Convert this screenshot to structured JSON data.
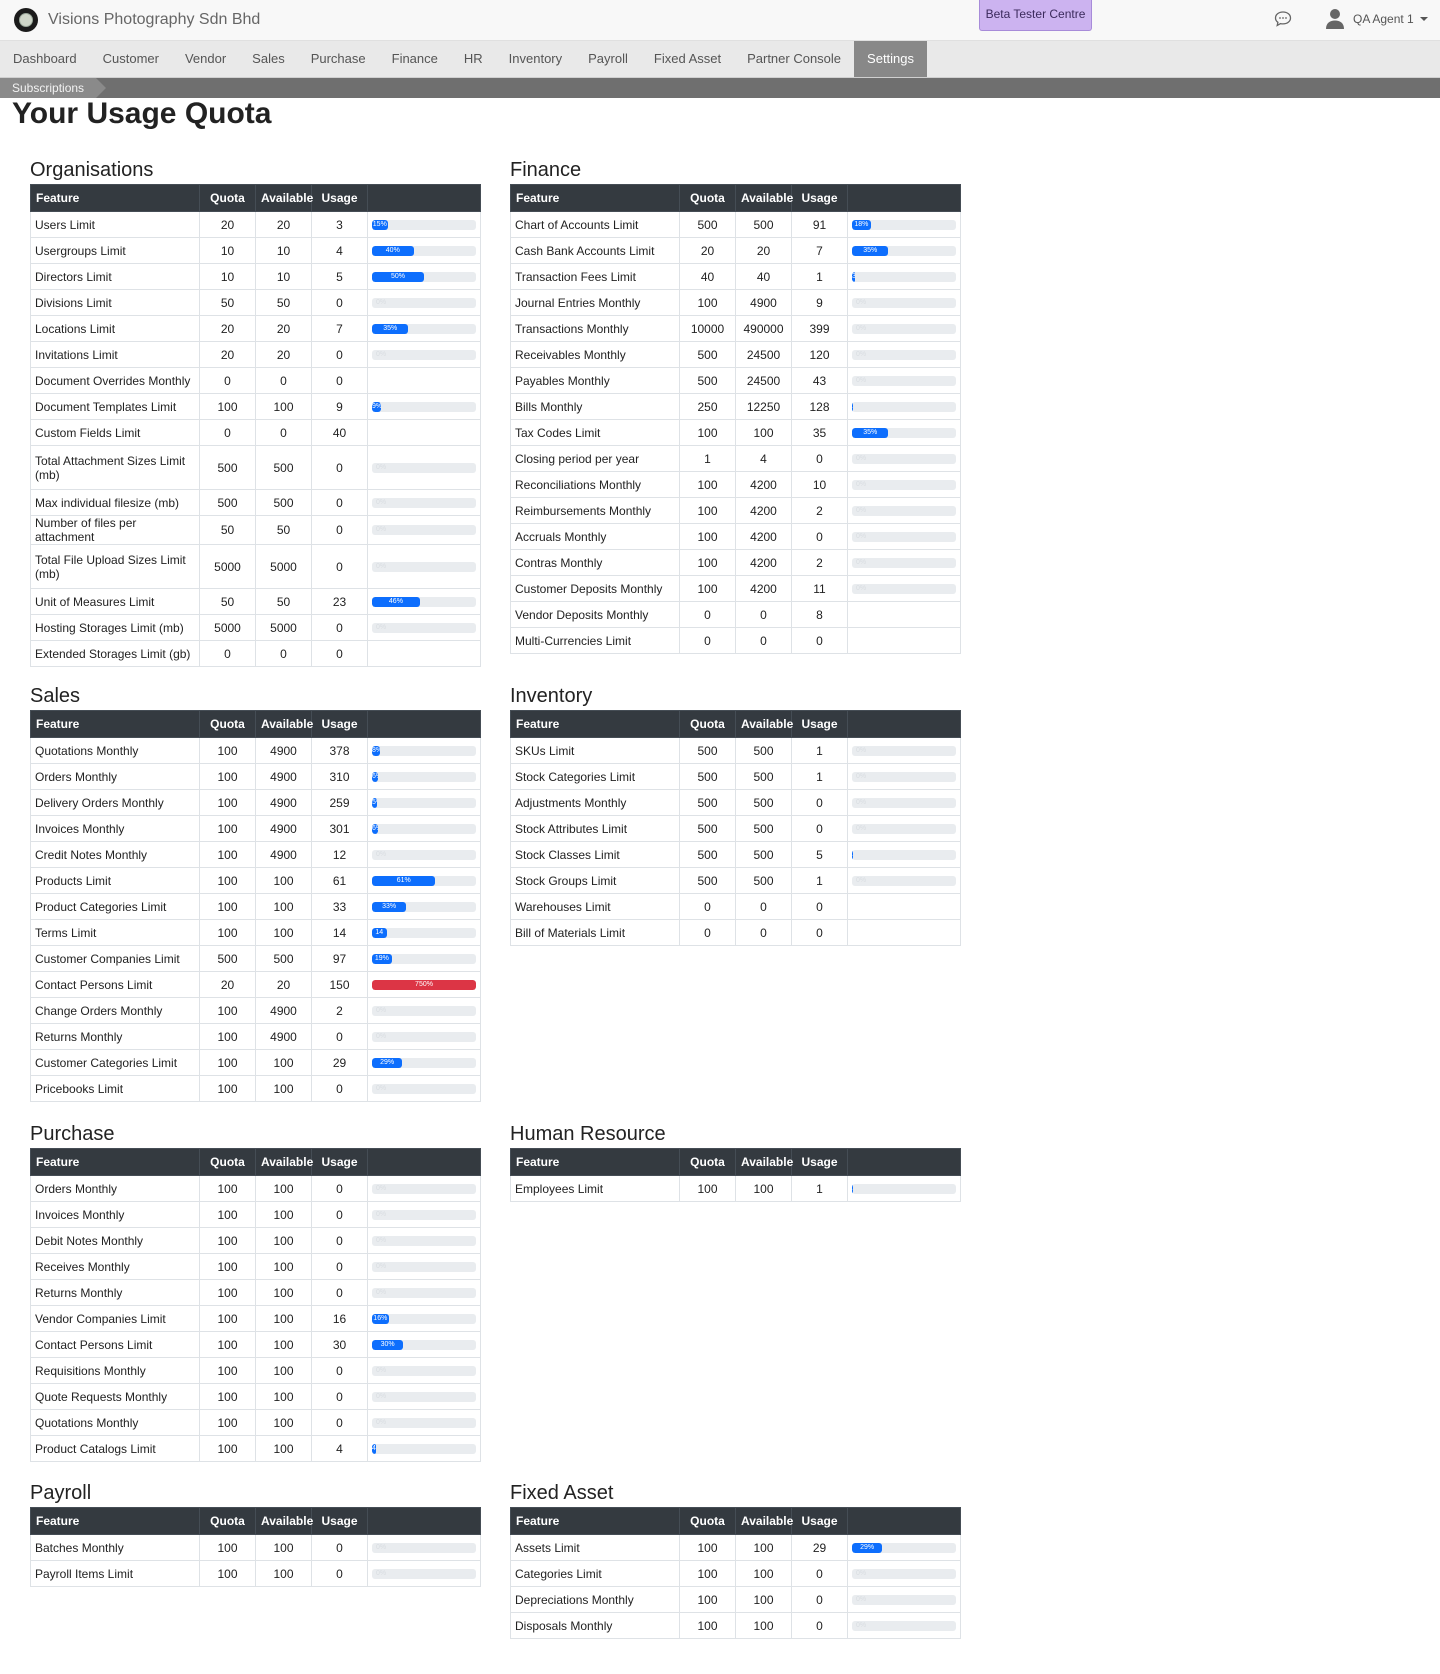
{
  "app": {
    "company": "Visions Photography Sdn Bhd",
    "beta_label": "Beta Tester Centre",
    "user_name": "QA Agent 1"
  },
  "nav": [
    "Dashboard",
    "Customer",
    "Vendor",
    "Sales",
    "Purchase",
    "Finance",
    "HR",
    "Inventory",
    "Payroll",
    "Fixed Asset",
    "Partner Console",
    "Settings"
  ],
  "nav_active": "Settings",
  "subnav": "Subscriptions",
  "page_title": "Your Usage Quota",
  "columns": {
    "feature": "Feature",
    "quota": "Quota",
    "available": "Available",
    "usage": "Usage"
  },
  "colors": {
    "header_bg": "#343a40",
    "progress": "#0d6efd",
    "over_quota": "#dc3545",
    "beta": "#ccb3f0"
  },
  "sections": [
    {
      "id": "organisations",
      "title": "Organisations",
      "rows": [
        {
          "feature": "Users Limit",
          "quota": "20",
          "available": "20",
          "usage": "3",
          "pct": 15,
          "label": "15%"
        },
        {
          "feature": "Usergroups Limit",
          "quota": "10",
          "available": "10",
          "usage": "4",
          "pct": 40,
          "label": "40%"
        },
        {
          "feature": "Directors Limit",
          "quota": "10",
          "available": "10",
          "usage": "5",
          "pct": 50,
          "label": "50%"
        },
        {
          "feature": "Divisions Limit",
          "quota": "50",
          "available": "50",
          "usage": "0",
          "pct": 0,
          "label": "0%"
        },
        {
          "feature": "Locations Limit",
          "quota": "20",
          "available": "20",
          "usage": "7",
          "pct": 35,
          "label": "35%"
        },
        {
          "feature": "Invitations Limit",
          "quota": "20",
          "available": "20",
          "usage": "0",
          "pct": 0,
          "label": "0%"
        },
        {
          "feature": "Document Overrides Monthly",
          "quota": "0",
          "available": "0",
          "usage": "0",
          "pct": null,
          "label": ""
        },
        {
          "feature": "Document Templates Limit",
          "quota": "100",
          "available": "100",
          "usage": "9",
          "pct": 9,
          "label": "9%"
        },
        {
          "feature": "Custom Fields Limit",
          "quota": "0",
          "available": "0",
          "usage": "40",
          "pct": null,
          "label": ""
        },
        {
          "feature": "Total Attachment Sizes Limit (mb)",
          "quota": "500",
          "available": "500",
          "usage": "0",
          "pct": 0,
          "label": "0%",
          "tall": true
        },
        {
          "feature": "Max individual filesize (mb)",
          "quota": "500",
          "available": "500",
          "usage": "0",
          "pct": 0,
          "label": "0%"
        },
        {
          "feature": "Number of files per attachment",
          "quota": "50",
          "available": "50",
          "usage": "0",
          "pct": 0,
          "label": "0%"
        },
        {
          "feature": "Total File Upload Sizes Limit (mb)",
          "quota": "5000",
          "available": "5000",
          "usage": "0",
          "pct": 0,
          "label": "0%",
          "tall": true
        },
        {
          "feature": "Unit of Measures Limit",
          "quota": "50",
          "available": "50",
          "usage": "23",
          "pct": 46,
          "label": "46%"
        },
        {
          "feature": "Hosting Storages Limit (mb)",
          "quota": "5000",
          "available": "5000",
          "usage": "0",
          "pct": 0,
          "label": "0%"
        },
        {
          "feature": "Extended Storages Limit (gb)",
          "quota": "0",
          "available": "0",
          "usage": "0",
          "pct": null,
          "label": ""
        }
      ]
    },
    {
      "id": "finance",
      "title": "Finance",
      "rows": [
        {
          "feature": "Chart of Accounts Limit",
          "quota": "500",
          "available": "500",
          "usage": "91",
          "pct": 18,
          "label": "18%"
        },
        {
          "feature": "Cash Bank Accounts Limit",
          "quota": "20",
          "available": "20",
          "usage": "7",
          "pct": 35,
          "label": "35%"
        },
        {
          "feature": "Transaction Fees Limit",
          "quota": "40",
          "available": "40",
          "usage": "1",
          "pct": 3,
          "label": "3%"
        },
        {
          "feature": "Journal Entries Monthly",
          "quota": "100",
          "available": "4900",
          "usage": "9",
          "pct": 0,
          "label": "0%"
        },
        {
          "feature": "Transactions Monthly",
          "quota": "10000",
          "available": "490000",
          "usage": "399",
          "pct": 0,
          "label": "0%"
        },
        {
          "feature": "Receivables Monthly",
          "quota": "500",
          "available": "24500",
          "usage": "120",
          "pct": 0,
          "label": "0%"
        },
        {
          "feature": "Payables Monthly",
          "quota": "500",
          "available": "24500",
          "usage": "43",
          "pct": 0,
          "label": "0%"
        },
        {
          "feature": "Bills Monthly",
          "quota": "250",
          "available": "12250",
          "usage": "128",
          "pct": 1,
          "label": "1%"
        },
        {
          "feature": "Tax Codes Limit",
          "quota": "100",
          "available": "100",
          "usage": "35",
          "pct": 35,
          "label": "35%"
        },
        {
          "feature": "Closing period per year",
          "quota": "1",
          "available": "4",
          "usage": "0",
          "pct": 0,
          "label": "0%"
        },
        {
          "feature": "Reconciliations Monthly",
          "quota": "100",
          "available": "4200",
          "usage": "10",
          "pct": 0,
          "label": "0%"
        },
        {
          "feature": "Reimbursements Monthly",
          "quota": "100",
          "available": "4200",
          "usage": "2",
          "pct": 0,
          "label": "0%"
        },
        {
          "feature": "Accruals Monthly",
          "quota": "100",
          "available": "4200",
          "usage": "0",
          "pct": 0,
          "label": "0%"
        },
        {
          "feature": "Contras Monthly",
          "quota": "100",
          "available": "4200",
          "usage": "2",
          "pct": 0,
          "label": "0%"
        },
        {
          "feature": "Customer Deposits Monthly",
          "quota": "100",
          "available": "4200",
          "usage": "11",
          "pct": 0,
          "label": "0%"
        },
        {
          "feature": "Vendor Deposits Monthly",
          "quota": "0",
          "available": "0",
          "usage": "8",
          "pct": null,
          "label": ""
        },
        {
          "feature": "Multi-Currencies Limit",
          "quota": "0",
          "available": "0",
          "usage": "0",
          "pct": null,
          "label": ""
        }
      ]
    },
    {
      "id": "sales",
      "title": "Sales",
      "rows": [
        {
          "feature": "Quotations Monthly",
          "quota": "100",
          "available": "4900",
          "usage": "378",
          "pct": 8,
          "label": "8%"
        },
        {
          "feature": "Orders Monthly",
          "quota": "100",
          "available": "4900",
          "usage": "310",
          "pct": 6,
          "label": "6%"
        },
        {
          "feature": "Delivery Orders Monthly",
          "quota": "100",
          "available": "4900",
          "usage": "259",
          "pct": 5,
          "label": "5%"
        },
        {
          "feature": "Invoices Monthly",
          "quota": "100",
          "available": "4900",
          "usage": "301",
          "pct": 6,
          "label": "6%"
        },
        {
          "feature": "Credit Notes Monthly",
          "quota": "100",
          "available": "4900",
          "usage": "12",
          "pct": 0,
          "label": "0%"
        },
        {
          "feature": "Products Limit",
          "quota": "100",
          "available": "100",
          "usage": "61",
          "pct": 61,
          "label": "61%"
        },
        {
          "feature": "Product Categories Limit",
          "quota": "100",
          "available": "100",
          "usage": "33",
          "pct": 33,
          "label": "33%"
        },
        {
          "feature": "Terms Limit",
          "quota": "100",
          "available": "100",
          "usage": "14",
          "pct": 14,
          "label": "14"
        },
        {
          "feature": "Customer Companies Limit",
          "quota": "500",
          "available": "500",
          "usage": "97",
          "pct": 19,
          "label": "19%"
        },
        {
          "feature": "Contact Persons Limit",
          "quota": "20",
          "available": "20",
          "usage": "150",
          "pct": 100,
          "label": "750%",
          "over": true
        },
        {
          "feature": "Change Orders Monthly",
          "quota": "100",
          "available": "4900",
          "usage": "2",
          "pct": 0,
          "label": "0%"
        },
        {
          "feature": "Returns Monthly",
          "quota": "100",
          "available": "4900",
          "usage": "0",
          "pct": 0,
          "label": "0%"
        },
        {
          "feature": "Customer Categories Limit",
          "quota": "100",
          "available": "100",
          "usage": "29",
          "pct": 29,
          "label": "29%"
        },
        {
          "feature": "Pricebooks Limit",
          "quota": "100",
          "available": "100",
          "usage": "0",
          "pct": 0,
          "label": "0%"
        }
      ]
    },
    {
      "id": "inventory",
      "title": "Inventory",
      "rows": [
        {
          "feature": "SKUs Limit",
          "quota": "500",
          "available": "500",
          "usage": "1",
          "pct": 0,
          "label": "0%"
        },
        {
          "feature": "Stock Categories Limit",
          "quota": "500",
          "available": "500",
          "usage": "1",
          "pct": 0,
          "label": "0%"
        },
        {
          "feature": "Adjustments Monthly",
          "quota": "500",
          "available": "500",
          "usage": "0",
          "pct": 0,
          "label": "0%"
        },
        {
          "feature": "Stock Attributes Limit",
          "quota": "500",
          "available": "500",
          "usage": "0",
          "pct": 0,
          "label": "0%"
        },
        {
          "feature": "Stock Classes Limit",
          "quota": "500",
          "available": "500",
          "usage": "5",
          "pct": 1,
          "label": "1%"
        },
        {
          "feature": "Stock Groups Limit",
          "quota": "500",
          "available": "500",
          "usage": "1",
          "pct": 0,
          "label": "0%"
        },
        {
          "feature": "Warehouses Limit",
          "quota": "0",
          "available": "0",
          "usage": "0",
          "pct": null,
          "label": ""
        },
        {
          "feature": "Bill of Materials Limit",
          "quota": "0",
          "available": "0",
          "usage": "0",
          "pct": null,
          "label": ""
        }
      ]
    },
    {
      "id": "purchase",
      "title": "Purchase",
      "rows": [
        {
          "feature": "Orders Monthly",
          "quota": "100",
          "available": "100",
          "usage": "0",
          "pct": 0,
          "label": "0%"
        },
        {
          "feature": "Invoices Monthly",
          "quota": "100",
          "available": "100",
          "usage": "0",
          "pct": 0,
          "label": "0%"
        },
        {
          "feature": "Debit Notes Monthly",
          "quota": "100",
          "available": "100",
          "usage": "0",
          "pct": 0,
          "label": "0%"
        },
        {
          "feature": "Receives Monthly",
          "quota": "100",
          "available": "100",
          "usage": "0",
          "pct": 0,
          "label": "0%"
        },
        {
          "feature": "Returns Monthly",
          "quota": "100",
          "available": "100",
          "usage": "0",
          "pct": 0,
          "label": "0%"
        },
        {
          "feature": "Vendor Companies Limit",
          "quota": "100",
          "available": "100",
          "usage": "16",
          "pct": 16,
          "label": "16%"
        },
        {
          "feature": "Contact Persons Limit",
          "quota": "100",
          "available": "100",
          "usage": "30",
          "pct": 30,
          "label": "30%"
        },
        {
          "feature": "Requisitions Monthly",
          "quota": "100",
          "available": "100",
          "usage": "0",
          "pct": 0,
          "label": "0%"
        },
        {
          "feature": "Quote Requests Monthly",
          "quota": "100",
          "available": "100",
          "usage": "0",
          "pct": 0,
          "label": "0%"
        },
        {
          "feature": "Quotations Monthly",
          "quota": "100",
          "available": "100",
          "usage": "0",
          "pct": 0,
          "label": "0%"
        },
        {
          "feature": "Product Catalogs Limit",
          "quota": "100",
          "available": "100",
          "usage": "4",
          "pct": 4,
          "label": "4%"
        }
      ]
    },
    {
      "id": "human-resource",
      "title": "Human Resource",
      "rows": [
        {
          "feature": "Employees Limit",
          "quota": "100",
          "available": "100",
          "usage": "1",
          "pct": 1,
          "label": "1%"
        }
      ]
    },
    {
      "id": "payroll",
      "title": "Payroll",
      "rows": [
        {
          "feature": "Batches Monthly",
          "quota": "100",
          "available": "100",
          "usage": "0",
          "pct": 0,
          "label": "0%"
        },
        {
          "feature": "Payroll Items Limit",
          "quota": "100",
          "available": "100",
          "usage": "0",
          "pct": 0,
          "label": "0%"
        }
      ]
    },
    {
      "id": "fixed-asset",
      "title": "Fixed Asset",
      "rows": [
        {
          "feature": "Assets Limit",
          "quota": "100",
          "available": "100",
          "usage": "29",
          "pct": 29,
          "label": "29%"
        },
        {
          "feature": "Categories Limit",
          "quota": "100",
          "available": "100",
          "usage": "0",
          "pct": 0,
          "label": "0%"
        },
        {
          "feature": "Depreciations Monthly",
          "quota": "100",
          "available": "100",
          "usage": "0",
          "pct": 0,
          "label": "0%"
        },
        {
          "feature": "Disposals Monthly",
          "quota": "100",
          "available": "100",
          "usage": "0",
          "pct": 0,
          "label": "0%"
        }
      ]
    }
  ]
}
